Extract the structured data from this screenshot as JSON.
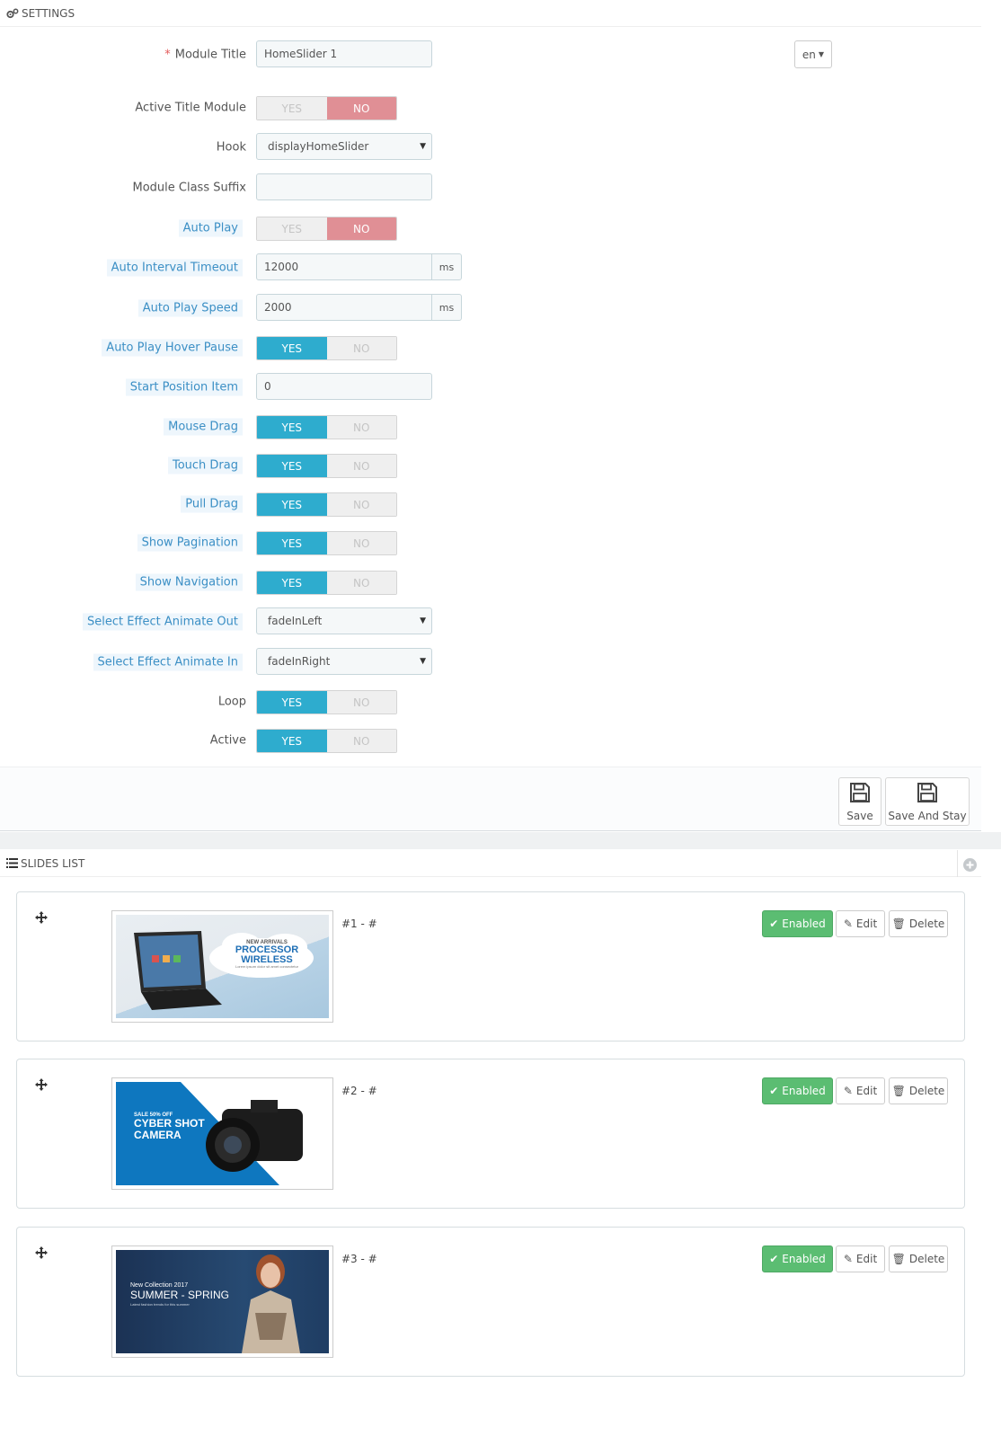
{
  "settings": {
    "heading": "SETTINGS",
    "module_title": {
      "label": "Module Title",
      "required_mark": "*",
      "value": "HomeSlider 1"
    },
    "lang": "en",
    "active_title_module": {
      "label": "Active Title Module",
      "yes": "YES",
      "no": "NO",
      "value": false
    },
    "hook": {
      "label": "Hook",
      "value": "displayHomeSlider"
    },
    "module_class_suffix": {
      "label": "Module Class Suffix",
      "value": ""
    },
    "auto_play": {
      "label": "Auto Play",
      "yes": "YES",
      "no": "NO",
      "value": false
    },
    "auto_interval_timeout": {
      "label": "Auto Interval Timeout",
      "value": "12000",
      "unit": "ms"
    },
    "auto_play_speed": {
      "label": "Auto Play Speed",
      "value": "2000",
      "unit": "ms"
    },
    "auto_play_hover_pause": {
      "label": "Auto Play Hover Pause",
      "yes": "YES",
      "no": "NO",
      "value": true
    },
    "start_position_item": {
      "label": "Start Position Item",
      "value": "0"
    },
    "mouse_drag": {
      "label": "Mouse Drag",
      "yes": "YES",
      "no": "NO",
      "value": true
    },
    "touch_drag": {
      "label": "Touch Drag",
      "yes": "YES",
      "no": "NO",
      "value": true
    },
    "pull_drag": {
      "label": "Pull Drag",
      "yes": "YES",
      "no": "NO",
      "value": true
    },
    "show_pagination": {
      "label": "Show Pagination",
      "yes": "YES",
      "no": "NO",
      "value": true
    },
    "show_navigation": {
      "label": "Show Navigation",
      "yes": "YES",
      "no": "NO",
      "value": true
    },
    "effect_out": {
      "label": "Select Effect Animate Out",
      "value": "fadeInLeft"
    },
    "effect_in": {
      "label": "Select Effect Animate In",
      "value": "fadeInRight"
    },
    "loop": {
      "label": "Loop",
      "yes": "YES",
      "no": "NO",
      "value": true
    },
    "active": {
      "label": "Active",
      "yes": "YES",
      "no": "NO",
      "value": true
    },
    "save_label": "Save",
    "save_stay_label": "Save And Stay"
  },
  "slides": {
    "heading": "SLIDES LIST",
    "items": [
      {
        "label": "#1 - #",
        "enabled_label": "Enabled",
        "edit_label": "Edit",
        "delete_label": "Delete",
        "banner": {
          "line1": "NEW ARRIVALS",
          "line2": "PROCESSOR",
          "line3": "WIRELESS",
          "line4": "Lorem ipsum dolor sit amet consectetur"
        }
      },
      {
        "label": "#2 - #",
        "enabled_label": "Enabled",
        "edit_label": "Edit",
        "delete_label": "Delete",
        "banner": {
          "line1": "SALE 50% OFF",
          "line2": "CYBER SHOT",
          "line3": "CAMERA"
        }
      },
      {
        "label": "#3 - #",
        "enabled_label": "Enabled",
        "edit_label": "Edit",
        "delete_label": "Delete",
        "banner": {
          "line1": "New Collection 2017",
          "line2": "SUMMER - SPRING",
          "line3": "Latest fashion trends for this summer"
        }
      }
    ]
  },
  "colors": {
    "switch_on": "#2eacce",
    "switch_no_on": "#e08f95",
    "enabled": "#5bbd72",
    "label_highlight": "#3b8fc5"
  }
}
